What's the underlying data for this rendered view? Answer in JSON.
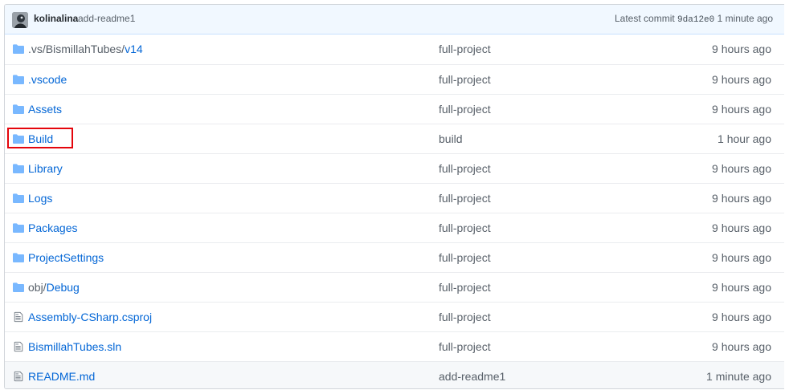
{
  "commit": {
    "author": "kolinalina",
    "message": "add-readme1",
    "latest_label": "Latest commit",
    "sha": "9da12e0",
    "time": "1 minute ago"
  },
  "files": [
    {
      "type": "folder",
      "name_prefix": ".vs/BismillahTubes/",
      "name": "v14",
      "message": "full-project",
      "age": "9 hours ago"
    },
    {
      "type": "folder",
      "name_prefix": "",
      "name": ".vscode",
      "message": "full-project",
      "age": "9 hours ago"
    },
    {
      "type": "folder",
      "name_prefix": "",
      "name": "Assets",
      "message": "full-project",
      "age": "9 hours ago"
    },
    {
      "type": "folder",
      "name_prefix": "",
      "name": "Build",
      "message": "build",
      "age": "1 hour ago",
      "highlighted": true
    },
    {
      "type": "folder",
      "name_prefix": "",
      "name": "Library",
      "message": "full-project",
      "age": "9 hours ago"
    },
    {
      "type": "folder",
      "name_prefix": "",
      "name": "Logs",
      "message": "full-project",
      "age": "9 hours ago"
    },
    {
      "type": "folder",
      "name_prefix": "",
      "name": "Packages",
      "message": "full-project",
      "age": "9 hours ago"
    },
    {
      "type": "folder",
      "name_prefix": "",
      "name": "ProjectSettings",
      "message": "full-project",
      "age": "9 hours ago"
    },
    {
      "type": "folder",
      "name_prefix": "obj/",
      "name": "Debug",
      "message": "full-project",
      "age": "9 hours ago"
    },
    {
      "type": "file",
      "name_prefix": "",
      "name": "Assembly-CSharp.csproj",
      "message": "full-project",
      "age": "9 hours ago"
    },
    {
      "type": "file",
      "name_prefix": "",
      "name": "BismillahTubes.sln",
      "message": "full-project",
      "age": "9 hours ago"
    },
    {
      "type": "file",
      "name_prefix": "",
      "name": "README.md",
      "message": "add-readme1",
      "age": "1 minute ago"
    }
  ],
  "colors": {
    "link": "#0366d6",
    "muted": "#586069",
    "folder_icon": "#79b8ff",
    "highlight_box": "#e4050c",
    "commit_bar_bg": "#f1f8ff"
  }
}
